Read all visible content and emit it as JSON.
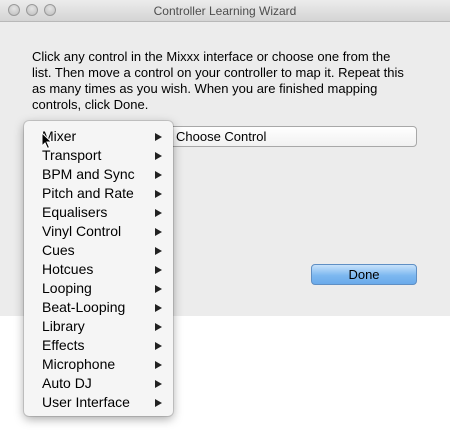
{
  "window": {
    "title": "Controller Learning Wizard",
    "instructions": "Click any control in the Mixxx interface or choose one from the list. Then move a control on your controller to map it. Repeat this as many times as you wish. When you are finished mapping controls, click Done.",
    "choose_control_label": "Choose Control",
    "done_label": "Done",
    "accent_color": "#7db8f0"
  },
  "menu": {
    "items": [
      {
        "label": "Mixer"
      },
      {
        "label": "Transport"
      },
      {
        "label": "BPM and Sync"
      },
      {
        "label": "Pitch and Rate"
      },
      {
        "label": "Equalisers"
      },
      {
        "label": "Vinyl Control"
      },
      {
        "label": "Cues"
      },
      {
        "label": "Hotcues"
      },
      {
        "label": "Looping"
      },
      {
        "label": "Beat-Looping"
      },
      {
        "label": "Library"
      },
      {
        "label": "Effects"
      },
      {
        "label": "Microphone"
      },
      {
        "label": "Auto DJ"
      },
      {
        "label": "User Interface"
      }
    ],
    "submenu_icon": "chevron-right-icon"
  }
}
